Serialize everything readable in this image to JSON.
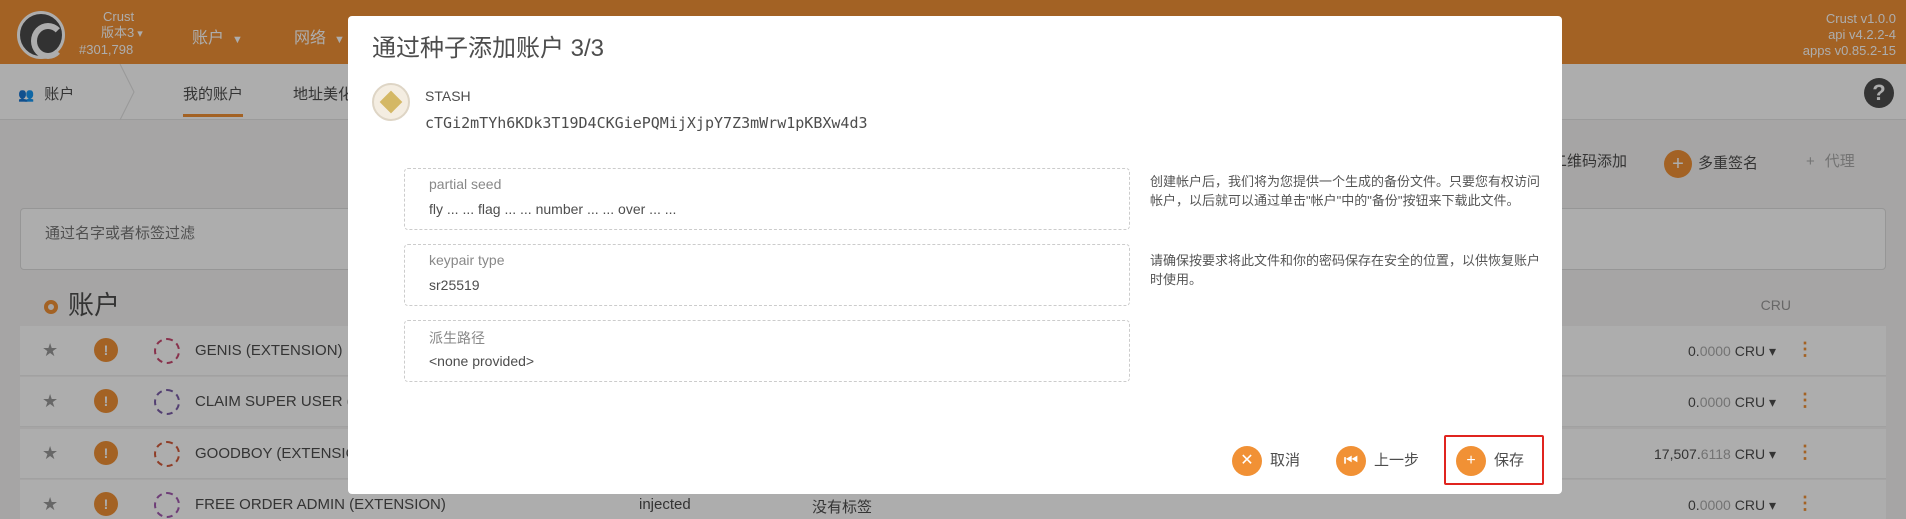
{
  "topbar": {
    "chain_name": "Crust",
    "version": "版本3",
    "block": "#301,798",
    "menu": [
      {
        "label": "账户"
      },
      {
        "label": "网络"
      }
    ],
    "right_versions": [
      "Crust v1.0.0",
      "api v4.2.2-4",
      "apps v0.85.2-15"
    ]
  },
  "subnav": {
    "section": "账户",
    "tabs": [
      "我的账户",
      "地址美化"
    ]
  },
  "page_actions": {
    "qr_add": "二维码添加",
    "multisig": "多重签名",
    "proxy": "代理"
  },
  "filter": {
    "placeholder": "通过名字或者标签过滤"
  },
  "accounts": {
    "title": "账户",
    "balance_header": "CRU",
    "rows": [
      {
        "name": "GENIS (EXTENSION)",
        "type": "",
        "tags": "",
        "balance_int": "0.",
        "balance_dec": "0000",
        "unit": "CRU"
      },
      {
        "name": "CLAIM SUPER USER (E",
        "type": "",
        "tags": "",
        "balance_int": "0.",
        "balance_dec": "0000",
        "unit": "CRU"
      },
      {
        "name": "GOODBOY (EXTENSIO",
        "type": "",
        "tags": "",
        "balance_int": "17,507.",
        "balance_dec": "6118",
        "unit": "CRU"
      },
      {
        "name": "FREE ORDER ADMIN (EXTENSION)",
        "type": "injected",
        "tags": "没有标签",
        "balance_int": "0.",
        "balance_dec": "0000",
        "unit": "CRU"
      }
    ]
  },
  "modal": {
    "title": "通过种子添加账户 3/3",
    "stash_label": "STASH",
    "stash_address": "cTGi2mTYh6KDk3T19D4CKGiePQMijXjpY7Z3mWrw1pKBXw4d3",
    "fields": [
      {
        "label": "partial seed",
        "value": "fly ... ... flag ... ... number ... ... over ... ..."
      },
      {
        "label": "keypair type",
        "value": "sr25519"
      },
      {
        "label": "派生路径",
        "value": "<none provided>"
      }
    ],
    "help": [
      "创建帐户后，我们将为您提供一个生成的备份文件。只要您有权访问帐户，以后就可以通过单击\"帐户\"中的\"备份\"按钮来下载此文件。",
      "请确保按要求将此文件和你的密码保存在安全的位置，以供恢复账户时使用。"
    ],
    "buttons": {
      "cancel": "取消",
      "back": "上一步",
      "save": "保存"
    }
  },
  "colors": {
    "accent": "#f19135",
    "highlight_box": "#e0241f"
  }
}
